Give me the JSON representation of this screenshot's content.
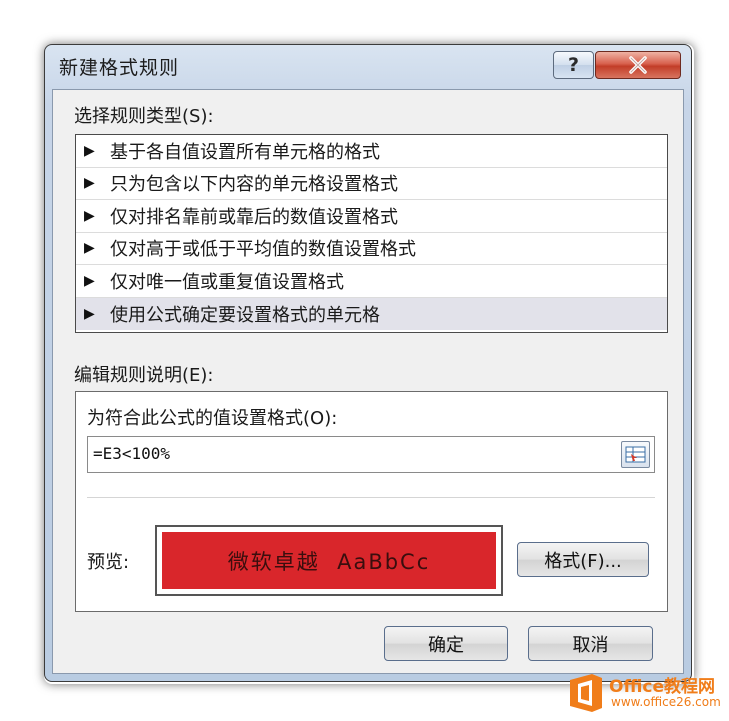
{
  "window": {
    "title": "新建格式规则",
    "help_label": "?"
  },
  "rule_type": {
    "label": "选择规则类型(S):",
    "items": [
      {
        "label": "基于各自值设置所有单元格的格式"
      },
      {
        "label": "只为包含以下内容的单元格设置格式"
      },
      {
        "label": "仅对排名靠前或靠后的数值设置格式"
      },
      {
        "label": "仅对高于或低于平均值的数值设置格式"
      },
      {
        "label": "仅对唯一值或重复值设置格式"
      },
      {
        "label": "使用公式确定要设置格式的单元格",
        "selected": true
      }
    ]
  },
  "rule_description": {
    "label": "编辑规则说明(E):",
    "formula_label": "为符合此公式的值设置格式(O):",
    "formula_value": "=E3<100%",
    "preview_label": "预览:",
    "preview_text": "微软卓越  AaBbCc",
    "preview_fill_color": "#d9262b",
    "format_button": "格式(F)..."
  },
  "buttons": {
    "ok": "确定",
    "cancel": "取消"
  },
  "watermark": {
    "name": "Office教程网",
    "url": "www.office26.com",
    "color": "#f07d1a"
  }
}
